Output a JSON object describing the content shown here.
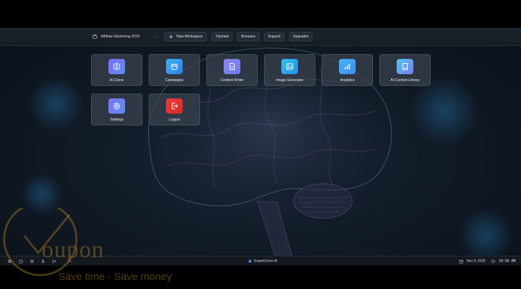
{
  "topbar": {
    "workspace_value": "Affiliate Marketing 2025",
    "buttons": [
      {
        "label": "New Workspace",
        "icon": "plus-icon"
      },
      {
        "label": "Tutorials"
      },
      {
        "label": "Bonuses"
      },
      {
        "label": "Support"
      },
      {
        "label": "Upgrades"
      }
    ]
  },
  "tiles": [
    {
      "label": "AI Clone",
      "icon": "clone-icon"
    },
    {
      "label": "Campaigns",
      "icon": "calendar-icon"
    },
    {
      "label": "Content Writer",
      "icon": "document-icon"
    },
    {
      "label": "Image Generator",
      "icon": "image-icon"
    },
    {
      "label": "Analytics",
      "icon": "bar-chart-icon"
    },
    {
      "label": "AI Content Library",
      "icon": "book-icon"
    },
    {
      "label": "Settings",
      "icon": "gear-icon"
    },
    {
      "label": "Logout",
      "icon": "logout-icon"
    }
  ],
  "taskbar": {
    "app_name": "ExpertClone AI",
    "date": "Nov 9, 2025",
    "time": "10:30 AM"
  },
  "watermark": {
    "brand": "oupon",
    "tagline": "Save time - Save money"
  },
  "colors": {
    "accent": "#4f8df5",
    "logout": "#e03131",
    "background": "#111a27"
  }
}
